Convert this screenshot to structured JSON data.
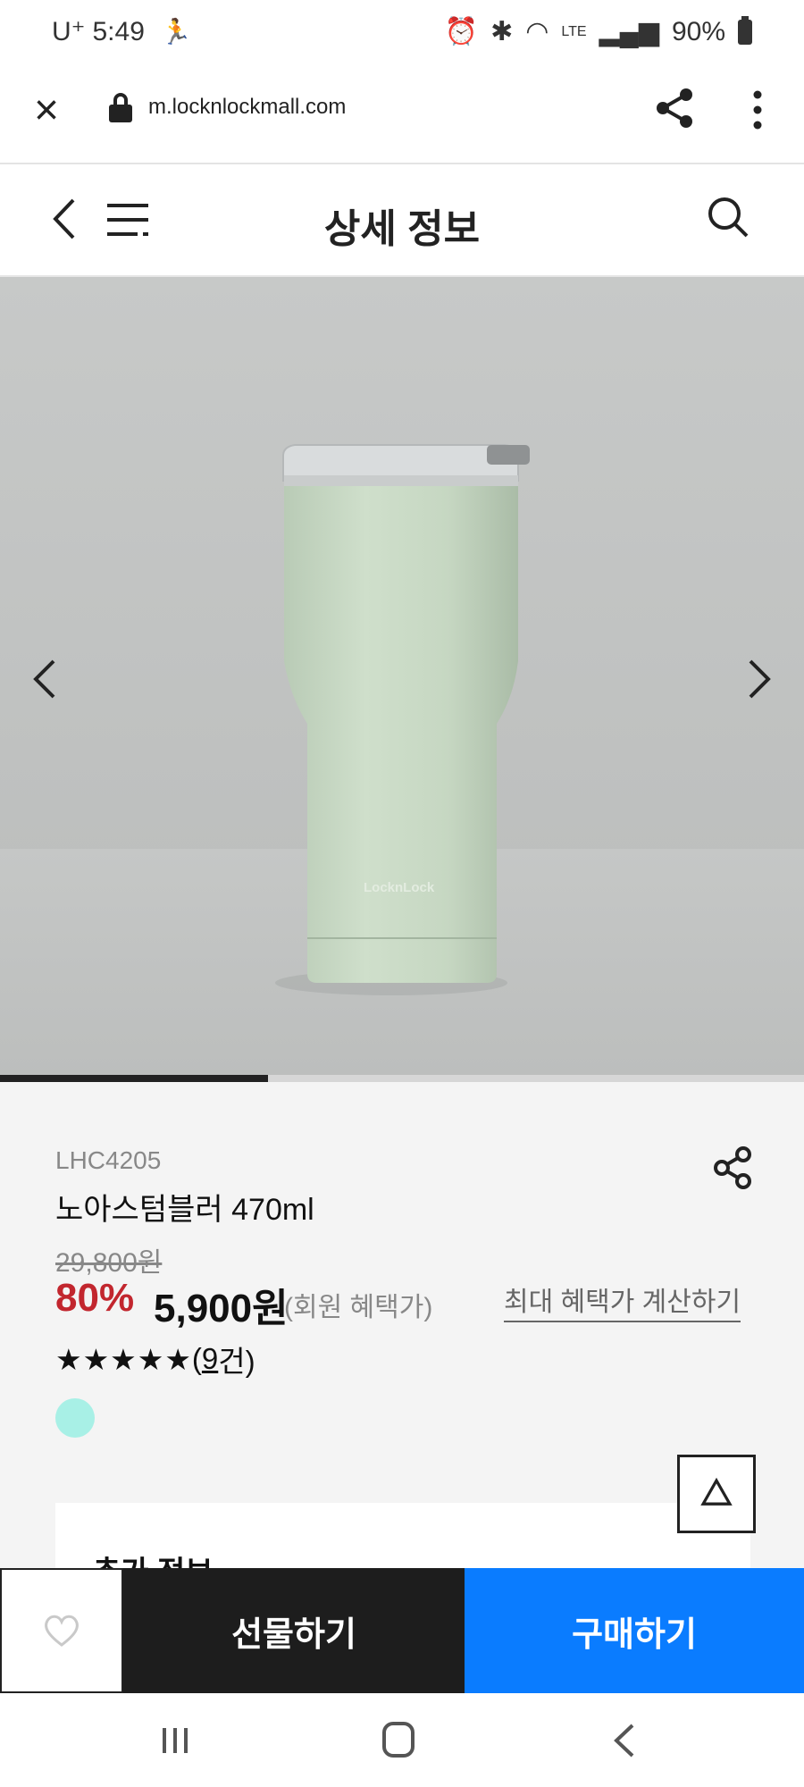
{
  "status_bar": {
    "carrier": "U⁺",
    "time": "5:49",
    "network": "LTE",
    "battery": "90%"
  },
  "browser": {
    "url": "m.locknlockmall.com"
  },
  "header": {
    "title": "상세 정보"
  },
  "gallery": {
    "progress_fraction": 0.333,
    "tumbler_logo": "LocknLock"
  },
  "product": {
    "code": "LHC4205",
    "name": "노아스텀블러 470ml",
    "original_price": "29,800원",
    "discount": "80%",
    "sale_price": "5,900원",
    "member_note": "(회원 혜택가)",
    "calc_link": "최대 혜택가 계산하기",
    "stars": "★★★★★",
    "review_open": "(",
    "review_count": "9",
    "review_close": " 건)",
    "color_options": [
      "#a8f0e6"
    ]
  },
  "extra_info": {
    "title": "추가 정보"
  },
  "actions": {
    "gift_label": "선물하기",
    "buy_label": "구매하기"
  },
  "colors": {
    "accent_blue": "#0a7cff",
    "discount_red": "#c2262e",
    "dark_button": "#1d1d1d"
  },
  "icons": [
    "close-icon",
    "lock-icon",
    "share-icon",
    "more-icon",
    "back-icon",
    "menu-icon",
    "search-icon",
    "chevron-left-icon",
    "chevron-right-icon",
    "heart-icon",
    "triangle-up-icon"
  ]
}
